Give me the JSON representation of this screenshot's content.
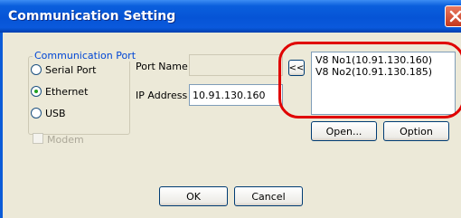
{
  "window": {
    "title": "Communication Setting"
  },
  "communication_port": {
    "legend": "Communication Port",
    "options": [
      {
        "label": "Serial Port",
        "selected": false
      },
      {
        "label": "Ethernet",
        "selected": true
      },
      {
        "label": "USB",
        "selected": false
      }
    ]
  },
  "modem": {
    "label": "Modem",
    "checked": false
  },
  "port_name": {
    "label": "Port Name",
    "value": ""
  },
  "ip_address": {
    "label": "IP Address",
    "value": "10.91.130.160"
  },
  "move_button": {
    "label": "<<"
  },
  "device_list": {
    "items": [
      "V8 No1(10.91.130.160)",
      "V8 No2(10.91.130.185)"
    ]
  },
  "buttons": {
    "open": "Open...",
    "option": "Option",
    "ok": "OK",
    "cancel": "Cancel"
  },
  "colors": {
    "title_bar": "#0654d6",
    "group_legend": "#0046d5",
    "highlight": "#e00000",
    "radio_dot": "#21a121"
  },
  "icons": {
    "close": "close-icon"
  }
}
